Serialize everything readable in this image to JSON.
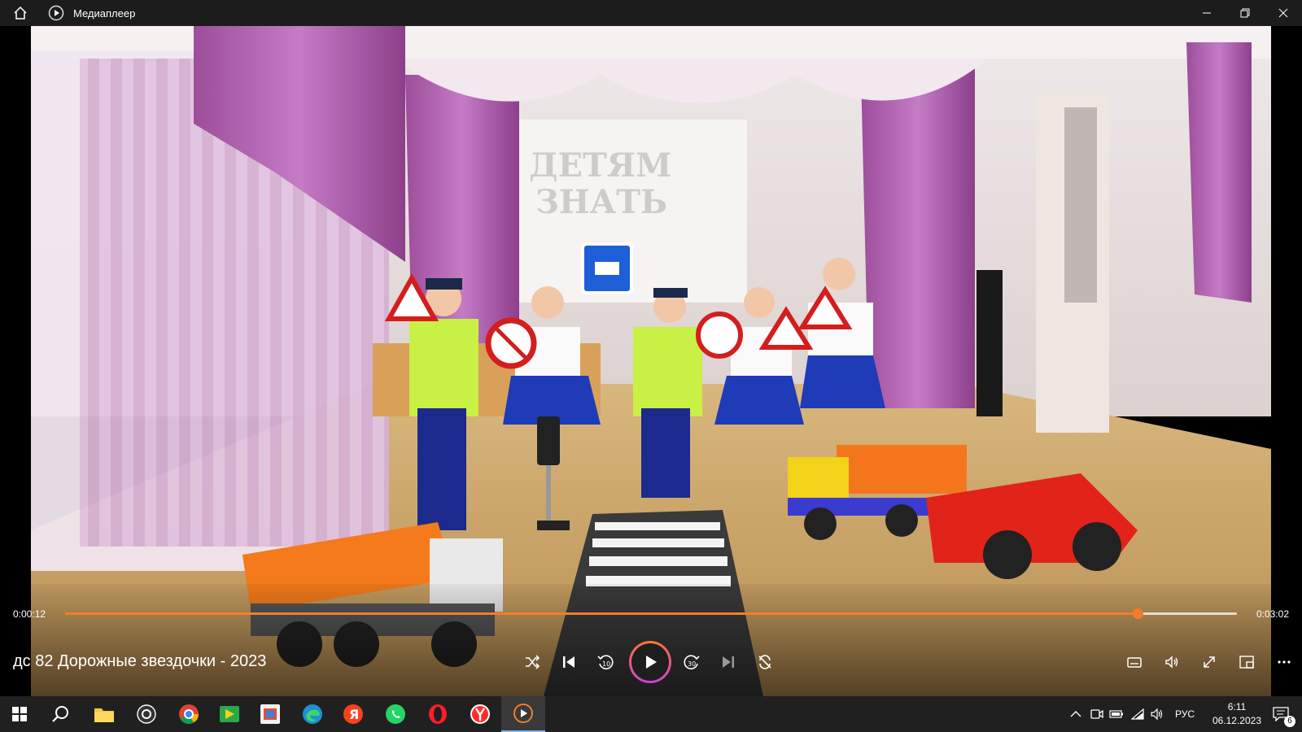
{
  "window": {
    "title": "Медиаплеер"
  },
  "video": {
    "screen_words": [
      "ДЕТЯМ",
      "ЗНАТЬ"
    ]
  },
  "player": {
    "current_time": "0:00:12",
    "total_time": "0:03:02",
    "progress": 0.915,
    "media_title": "дс 82 Дорожные звездочки - 2023",
    "accent_color": "#f07f2a",
    "controls": [
      "shuffle-icon",
      "previous-icon",
      "rewind-10-icon",
      "play-icon",
      "forward-30-icon",
      "next-icon",
      "repeat-off-icon",
      "subtitles-icon",
      "volume-icon",
      "fullscreen-icon",
      "mini-view-icon",
      "more-icon"
    ],
    "rewind_label": "10",
    "forward_label": "30"
  },
  "taskbar": {
    "apps": [
      "start",
      "search",
      "file-explorer",
      "obs",
      "chrome",
      "media-app",
      "app-store",
      "edge",
      "yandex",
      "whatsapp",
      "opera",
      "yandex-browser",
      "media-player"
    ],
    "language": "РУС",
    "time": "6:11",
    "date": "06.12.2023",
    "notifications": "6"
  }
}
